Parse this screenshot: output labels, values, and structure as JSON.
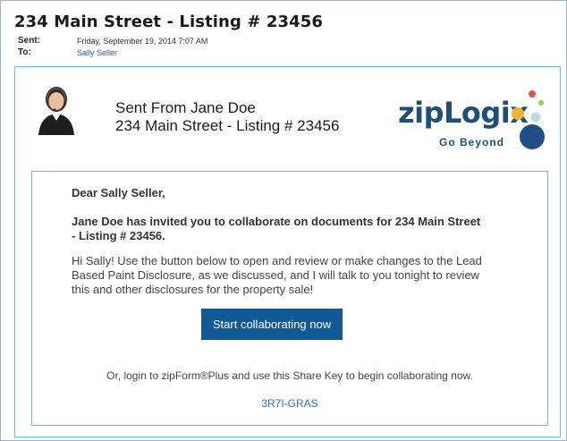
{
  "email": {
    "subject": "234 Main Street - Listing # 23456",
    "sent_label": "Sent:",
    "sent_value": "Friday, September 19, 2014 7:07 AM",
    "to_label": "To:",
    "to_value": "Sally Seller"
  },
  "header": {
    "sent_from_line1": "Sent From Jane Doe",
    "sent_from_line2": "234 Main Street - Listing # 23456",
    "logo_text": "zipLogix",
    "logo_tagline": "Go Beyond"
  },
  "message": {
    "greeting": "Dear Sally Seller,",
    "invite": "Jane Doe has invited you to collaborate on documents for 234 Main Street - Listing # 23456.",
    "body": "Hi Sally! Use the button below to open and review or make changes to the Lead Based Paint Disclosure, as we discussed, and I will talk to you tonight to review this and other disclosures for the property sale!",
    "cta_label": "Start collaborating now",
    "login_text": "Or, login to zipForm®Plus and use this Share Key to begin collaborating now.",
    "share_key": "3R7I-GRAS"
  },
  "colors": {
    "accent_border": "#6fb8e6",
    "button": "#0f5a96",
    "logo": "#1f4e79",
    "link": "#2a6fc9"
  },
  "icons": {
    "avatar": "agent-headset-avatar",
    "logo_mark": "ziplogix-dots-icon"
  }
}
